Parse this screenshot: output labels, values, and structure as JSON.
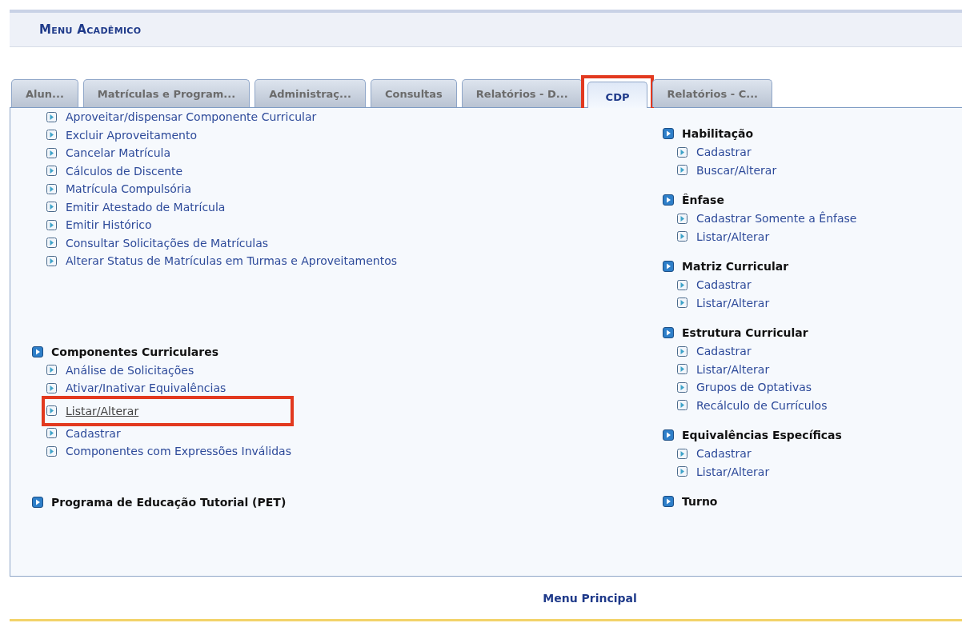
{
  "header": {
    "title": "Menu Acadêmico"
  },
  "tabs": [
    {
      "label": "Alun...",
      "selected": false,
      "highlighted": false
    },
    {
      "label": "Matrículas e Program...",
      "selected": false,
      "highlighted": false
    },
    {
      "label": "Administraç...",
      "selected": false,
      "highlighted": false
    },
    {
      "label": "Consultas",
      "selected": false,
      "highlighted": false
    },
    {
      "label": "Relatórios - D...",
      "selected": false,
      "highlighted": false
    },
    {
      "label": "CDP",
      "selected": true,
      "highlighted": true
    },
    {
      "label": "Relatórios - C...",
      "selected": false,
      "highlighted": false
    }
  ],
  "left_column": [
    {
      "items": [
        {
          "label": "Aproveitar/dispensar Componente Curricular",
          "hovered": false,
          "highlighted": false
        },
        {
          "label": "Excluir Aproveitamento",
          "hovered": false,
          "highlighted": false
        },
        {
          "label": "Cancelar Matrícula",
          "hovered": false,
          "highlighted": false
        },
        {
          "label": "Cálculos de Discente",
          "hovered": false,
          "highlighted": false
        },
        {
          "label": "Matrícula Compulsória",
          "hovered": false,
          "highlighted": false
        },
        {
          "label": "Emitir Atestado de Matrícula",
          "hovered": false,
          "highlighted": false
        },
        {
          "label": "Emitir Histórico",
          "hovered": false,
          "highlighted": false
        },
        {
          "label": "Consultar Solicitações de Matrículas",
          "hovered": false,
          "highlighted": false
        },
        {
          "label": "Alterar Status de Matrículas em Turmas e Aproveitamentos",
          "hovered": false,
          "highlighted": false
        }
      ]
    },
    {
      "title": "Componentes Curriculares",
      "items": [
        {
          "label": "Análise de Solicitações",
          "hovered": false,
          "highlighted": false
        },
        {
          "label": "Ativar/Inativar Equivalências",
          "hovered": false,
          "highlighted": false
        },
        {
          "label": "Listar/Alterar",
          "hovered": true,
          "highlighted": true
        },
        {
          "label": "Cadastrar",
          "hovered": false,
          "highlighted": false
        },
        {
          "label": "Componentes com Expressões Inválidas",
          "hovered": false,
          "highlighted": false
        }
      ]
    },
    {
      "title": "Programa de Educação Tutorial (PET)"
    }
  ],
  "right_column": [
    {
      "title": "Habilitação",
      "items": [
        {
          "label": "Cadastrar",
          "hovered": false,
          "highlighted": false
        },
        {
          "label": "Buscar/Alterar",
          "hovered": false,
          "highlighted": false
        }
      ]
    },
    {
      "title": "Ênfase",
      "items": [
        {
          "label": "Cadastrar Somente a Ênfase",
          "hovered": false,
          "highlighted": false
        },
        {
          "label": "Listar/Alterar",
          "hovered": false,
          "highlighted": false
        }
      ]
    },
    {
      "title": "Matriz Curricular",
      "items": [
        {
          "label": "Cadastrar",
          "hovered": false,
          "highlighted": false
        },
        {
          "label": "Listar/Alterar",
          "hovered": false,
          "highlighted": false
        }
      ]
    },
    {
      "title": "Estrutura Curricular",
      "items": [
        {
          "label": "Cadastrar",
          "hovered": false,
          "highlighted": false
        },
        {
          "label": "Listar/Alterar",
          "hovered": false,
          "highlighted": false
        },
        {
          "label": "Grupos de Optativas",
          "hovered": false,
          "highlighted": false
        },
        {
          "label": "Recálculo de Currículos",
          "hovered": false,
          "highlighted": false
        }
      ]
    },
    {
      "title": "Equivalências Específicas",
      "items": [
        {
          "label": "Cadastrar",
          "hovered": false,
          "highlighted": false
        },
        {
          "label": "Listar/Alterar",
          "hovered": false,
          "highlighted": false
        }
      ]
    },
    {
      "title": "Turno"
    }
  ],
  "footer": {
    "link": "Menu Principal"
  }
}
